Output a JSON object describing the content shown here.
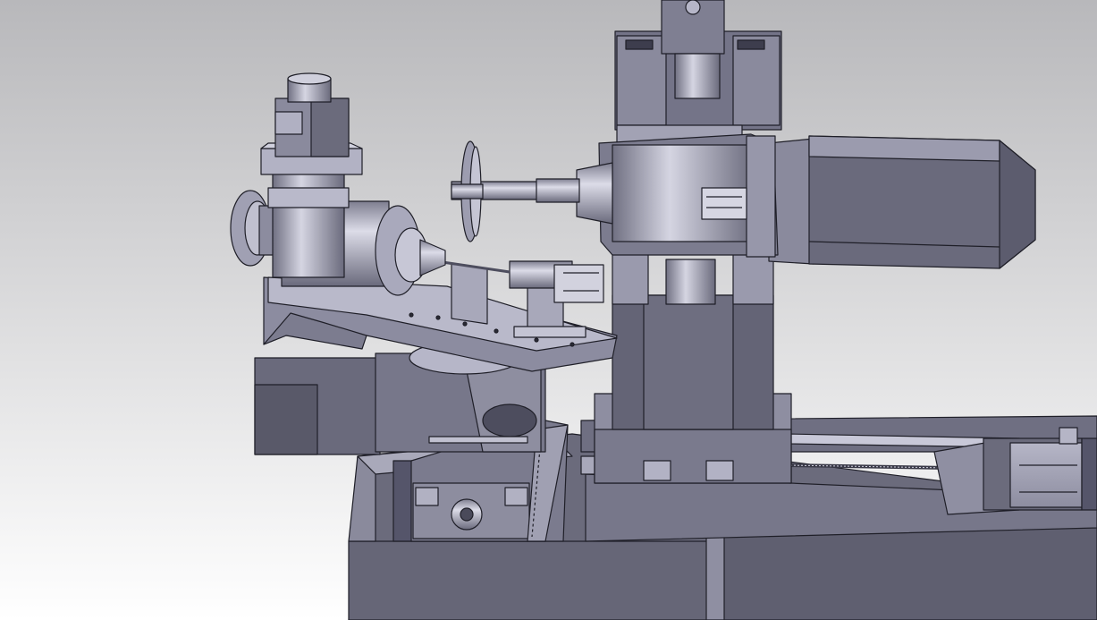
{
  "viewport": {
    "background_top": "#b8b8bb",
    "background_bottom": "#ffffff"
  },
  "model": {
    "body_color": "#6b6b7c",
    "face_color": "#a9a9ba",
    "dark_color": "#4a4a5a",
    "edge_color": "#1f1f28",
    "highlight_color": "#d7d7e4"
  },
  "parts": [
    "servo-motor-top",
    "rotary-head-assembly",
    "workpiece-spindle",
    "tailstock",
    "rotary-table-base",
    "vertical-column",
    "grinding-wheel",
    "grinding-spindle-housing",
    "spindle-drive-motor",
    "x-axis-ball-screw",
    "x-axis-servo-motor",
    "linear-guide-rail",
    "machine-bed"
  ]
}
